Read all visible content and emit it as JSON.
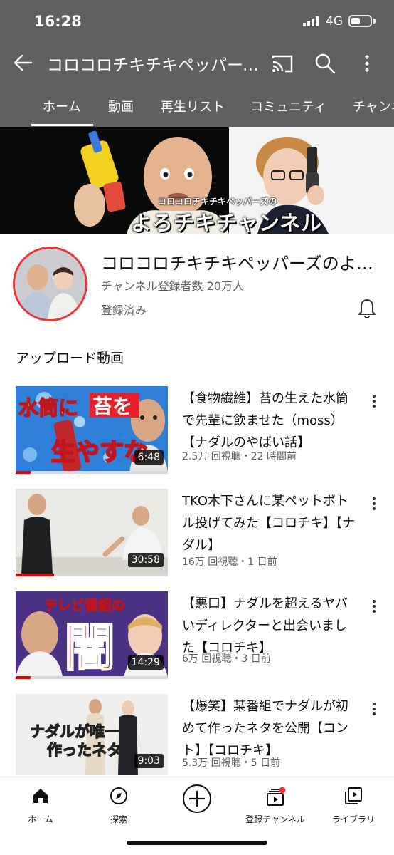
{
  "status_bar": {
    "time": "16:28",
    "network": "4G"
  },
  "app_bar": {
    "channel_title": "コロコロチキチキペッパーズのよろチキチャンネル"
  },
  "tabs": [
    {
      "label": "ホーム",
      "active": true
    },
    {
      "label": "動画"
    },
    {
      "label": "再生リスト"
    },
    {
      "label": "コミュニティ"
    },
    {
      "label": "チャンネル"
    }
  ],
  "banner": {
    "subtitle": "コロコロチキチキペッパーズの",
    "title": "よろチキチャンネル"
  },
  "channel": {
    "name": "コロコロチキチキペッパーズのよろチキチャンネル",
    "subscribers": "チャンネル登録者数 20万人",
    "subscribed": "登録済み"
  },
  "section_heading": "アップロード動画",
  "videos": [
    {
      "title": "【食物繊維】苔の生えた水筒で先輩に飲ませた（moss）【ナダルのやばい話】",
      "meta": "2.5万 回視聴・22 時間前",
      "duration": "6:48",
      "thumb_text": [
        "水筒に",
        "苔を",
        "生やすな"
      ],
      "watched_fraction": 0.1
    },
    {
      "title": "TKO木下さんに某ペットボトル投げてみた【コロチキ】【ナダル】",
      "meta": "16万 回視聴・1 日前",
      "duration": "30:58",
      "thumb_text": [],
      "watched_fraction": 0.25
    },
    {
      "title": "【悪口】ナダルを超えるヤバいディレクターと出会いました【コロチキ】",
      "meta": "6万 回視聴・3 日前",
      "duration": "14:29",
      "thumb_text": [
        "テレビ番組の",
        "闇"
      ],
      "watched_fraction": 0.1
    },
    {
      "title": "【爆笑】某番組でナダルが初めて作ったネタを公開【コント】【コロチキ】",
      "meta": "5.3万 回視聴・5 日前",
      "duration": "9:03",
      "thumb_text": [
        "ナダルが唯一",
        "作ったネタ"
      ],
      "watched_fraction": 0
    }
  ],
  "bottom_nav": [
    {
      "label": "ホーム",
      "icon": "home-icon",
      "active": true
    },
    {
      "label": "探索",
      "icon": "explore-icon"
    },
    {
      "label": "",
      "icon": "create-icon"
    },
    {
      "label": "登録チャンネル",
      "icon": "subscriptions-icon",
      "badge": true
    },
    {
      "label": "ライブラリ",
      "icon": "library-icon"
    }
  ]
}
